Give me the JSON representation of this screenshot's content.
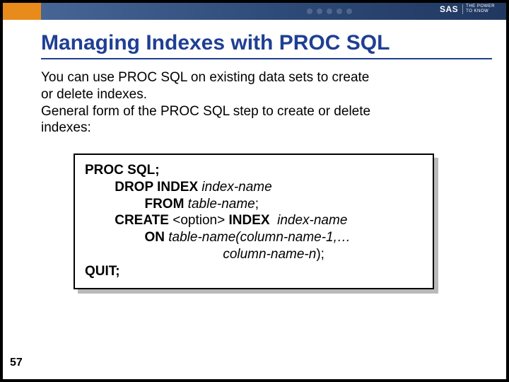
{
  "header": {
    "logo_text": "SAS",
    "logo_tag_line1": "THE POWER",
    "logo_tag_line2": "TO KNOW"
  },
  "title": "Managing Indexes with PROC SQL",
  "paragraph": {
    "line1": "You can use PROC SQL on existing data sets to create",
    "line2": "or delete indexes.",
    "line3": "General form of the PROC SQL step to create or delete",
    "line4": "indexes:"
  },
  "code": {
    "l1_bold": "PROC SQL;",
    "l2_indent": "        ",
    "l2_bold": "DROP INDEX",
    "l2_ital": " index-name",
    "l3_indent": "                ",
    "l3_bold": "FROM",
    "l3_ital": " table-name",
    "l3_tail": ";",
    "l4_indent": "        ",
    "l4_bold": "CREATE",
    "l4_mid": " <option> ",
    "l4_bold2": "INDEX",
    "l4_ital": "  index-name",
    "l5_indent": "                ",
    "l5_bold": "ON",
    "l5_ital": " table-name(column-name-1,…",
    "l6_indent": "                                     ",
    "l6_ital": "column-name-n",
    "l6_tail": ");",
    "l7_bold": "QUIT;"
  },
  "page_number": "57"
}
